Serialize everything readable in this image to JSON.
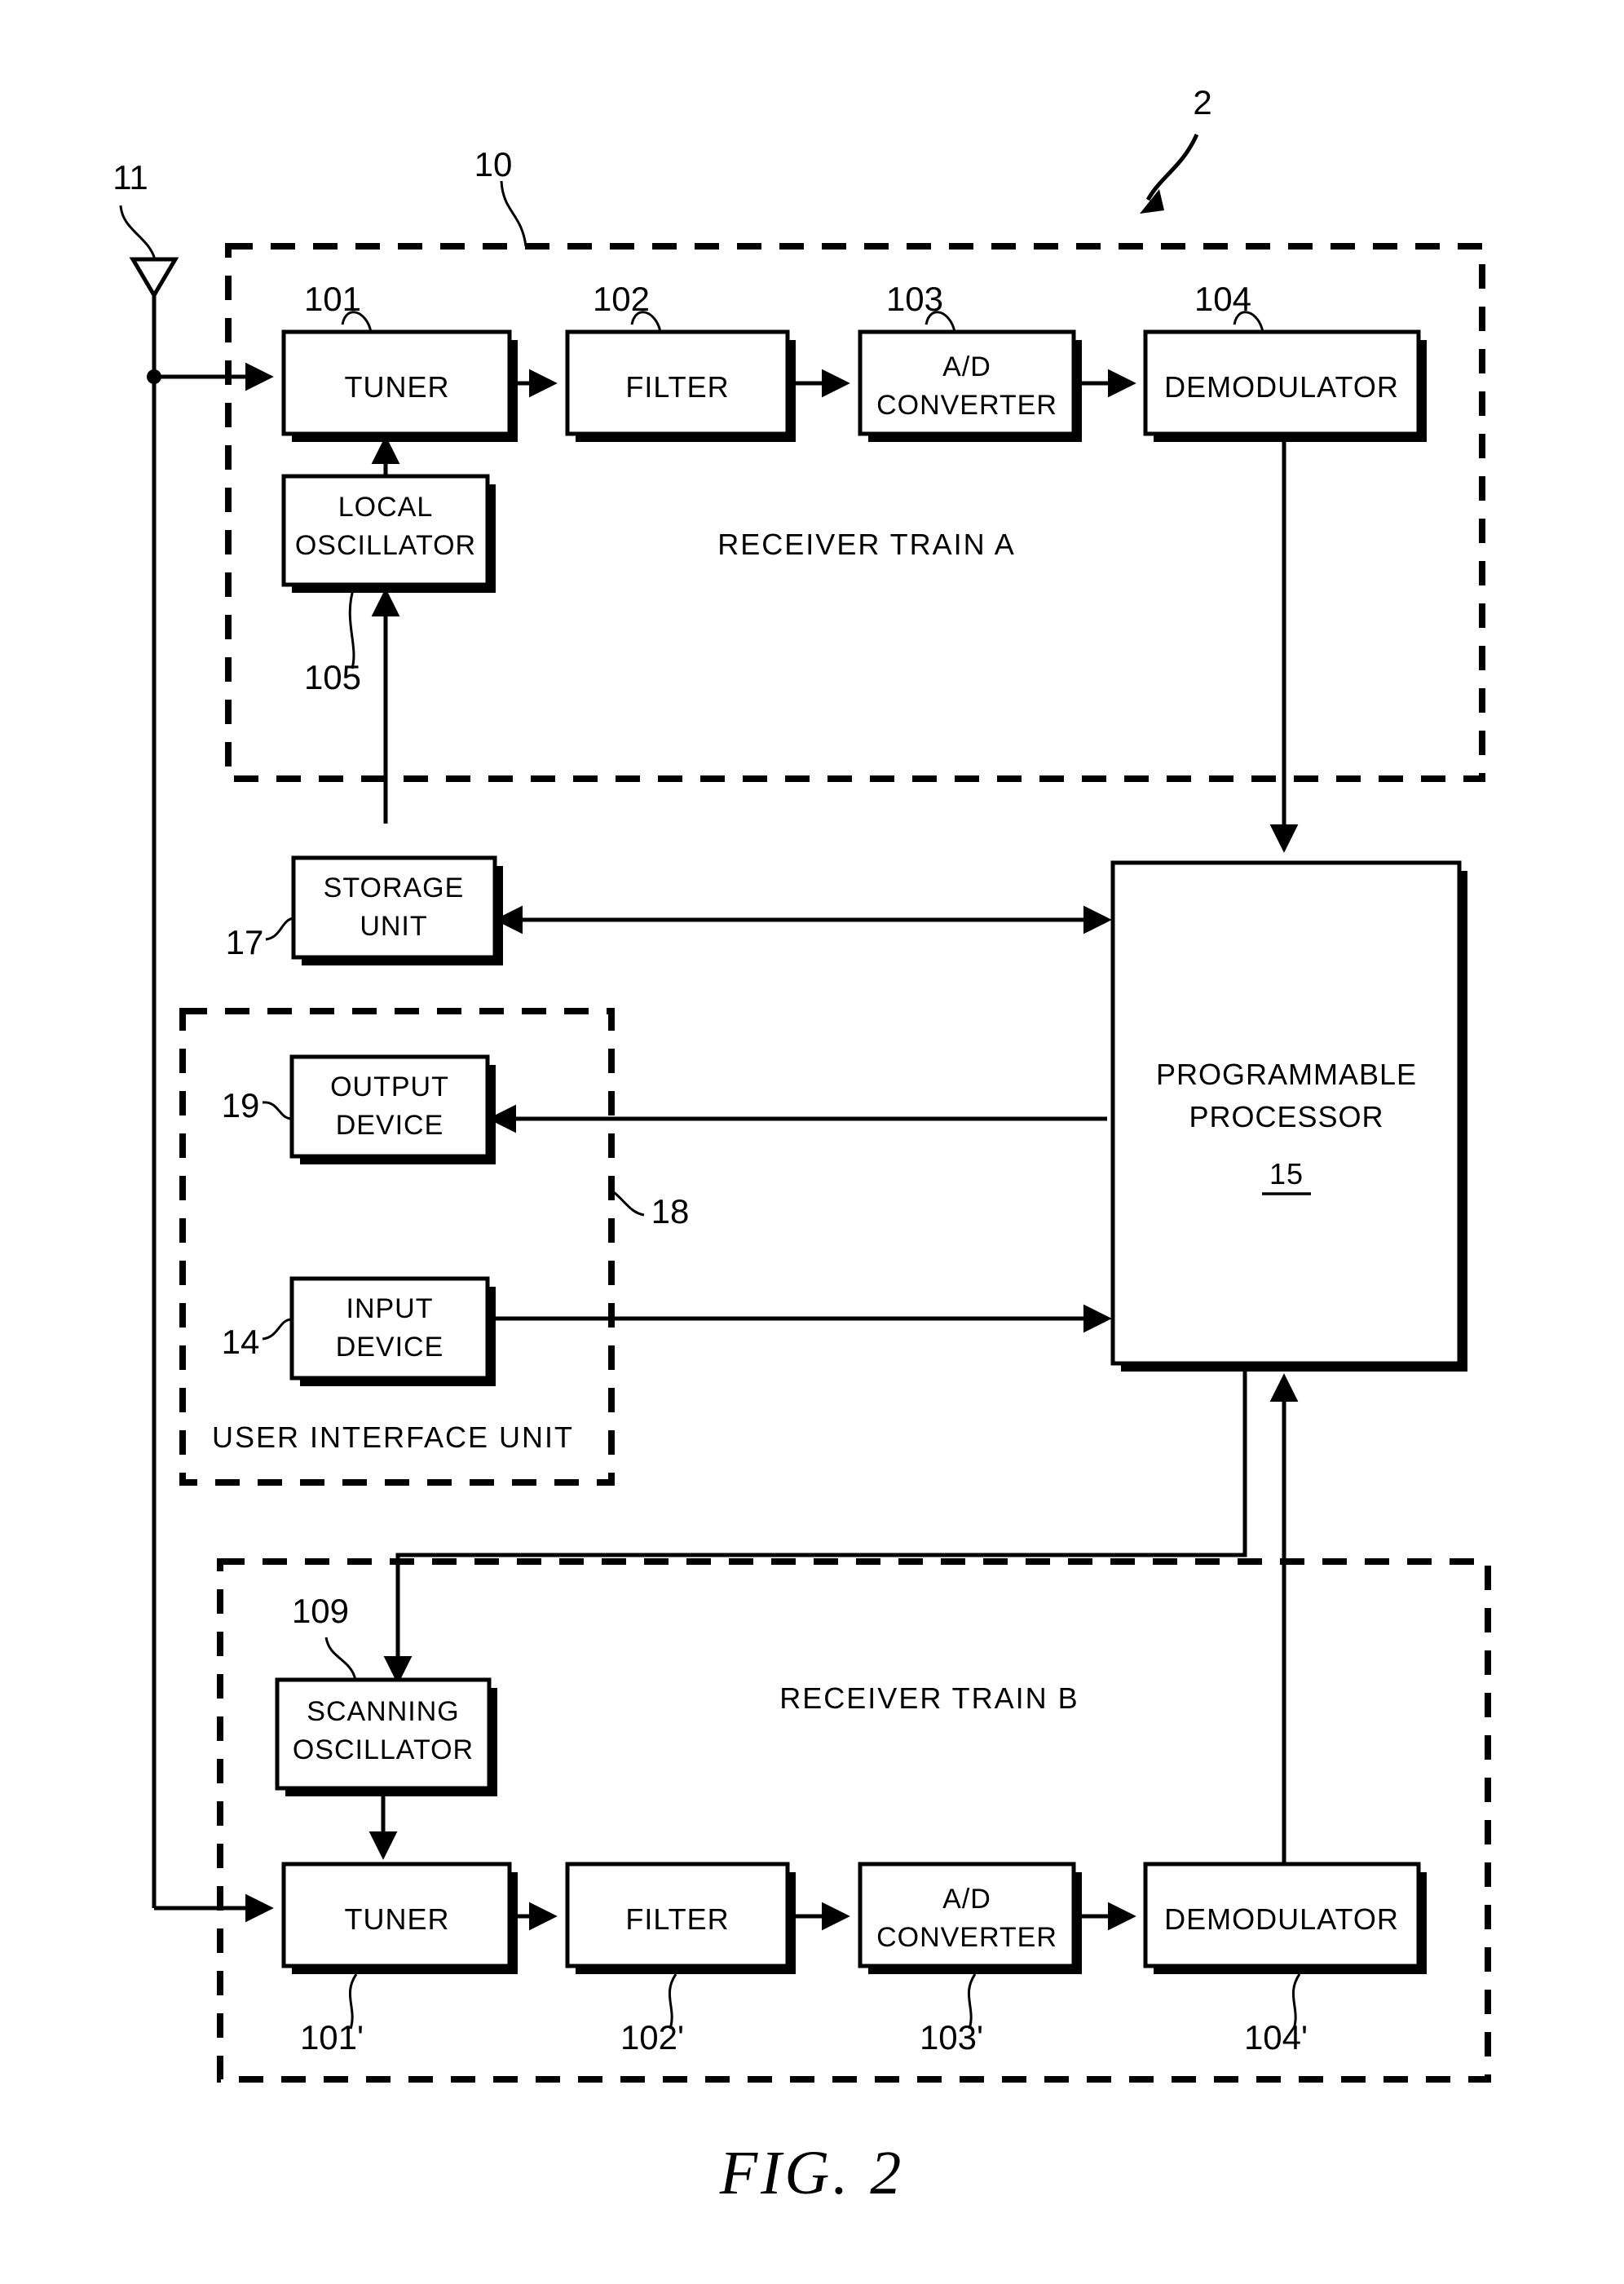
{
  "figure": {
    "caption": "FIG. 2",
    "system_ref": "2"
  },
  "antenna": {
    "ref": "11",
    "name": "antenna"
  },
  "receiver_train_a": {
    "ref": "10",
    "zone_label": "RECEIVER TRAIN A",
    "blocks": [
      {
        "label": "TUNER",
        "ref": "101"
      },
      {
        "label": "FILTER",
        "ref": "102"
      },
      {
        "label_line1": "A/D",
        "label_line2": "CONVERTER",
        "ref": "103"
      },
      {
        "label": "DEMODULATOR",
        "ref": "104"
      },
      {
        "label_line1": "LOCAL",
        "label_line2": "OSCILLATOR",
        "ref": "105"
      }
    ]
  },
  "receiver_train_b": {
    "zone_label": "RECEIVER TRAIN B",
    "blocks": [
      {
        "label_line1": "SCANNING",
        "label_line2": "OSCILLATOR",
        "ref": "109"
      },
      {
        "label": "TUNER",
        "ref": "101'"
      },
      {
        "label": "FILTER",
        "ref": "102'"
      },
      {
        "label_line1": "A/D",
        "label_line2": "CONVERTER",
        "ref": "103'"
      },
      {
        "label": "DEMODULATOR",
        "ref": "104'"
      }
    ]
  },
  "storage_unit": {
    "label_line1": "STORAGE",
    "label_line2": "UNIT",
    "ref": "17"
  },
  "user_interface_unit": {
    "zone_label": "USER INTERFACE UNIT",
    "ref": "18",
    "blocks": [
      {
        "label_line1": "OUTPUT",
        "label_line2": "DEVICE",
        "ref": "19"
      },
      {
        "label_line1": "INPUT",
        "label_line2": "DEVICE",
        "ref": "14"
      }
    ]
  },
  "processor": {
    "label_line1": "PROGRAMMABLE",
    "label_line2": "PROCESSOR",
    "ref": "15"
  },
  "colors": {
    "ink": "#000000",
    "paper": "#ffffff"
  }
}
